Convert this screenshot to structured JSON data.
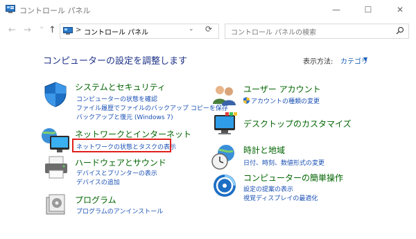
{
  "window": {
    "title": "コントロール パネル",
    "minimize": "—",
    "maximize": "☐",
    "close": "✕"
  },
  "nav": {
    "back": "←",
    "forward": "→",
    "recent": "⌄",
    "up": "↑"
  },
  "address": {
    "chevron": ">",
    "path": "コントロール パネル",
    "dropdown": "⌄",
    "refresh": "⟳"
  },
  "search": {
    "placeholder": "コントロール パネルの検索"
  },
  "main": {
    "heading": "コンピューターの設定を調整します",
    "view_by_label": "表示方法:",
    "view_by_value": "カテゴリ",
    "view_by_arrow": "▼"
  },
  "categories": [
    {
      "title": "システムとセキュリティ",
      "links": [
        "コンピューターの状態を確認",
        "ファイル履歴でファイルのバックアップ コピーを保存",
        "バックアップと復元 (Windows 7)"
      ]
    },
    {
      "title": "ネットワークとインターネット",
      "links": [
        "ネットワークの状態とタスクの表示"
      ]
    },
    {
      "title": "ハードウェアとサウンド",
      "links": [
        "デバイスとプリンターの表示",
        "デバイスの追加"
      ]
    },
    {
      "title": "プログラム",
      "links": [
        "プログラムのアンインストール"
      ]
    },
    {
      "title": "ユーザー アカウント",
      "links": [
        "アカウントの種類の変更"
      ]
    },
    {
      "title": "デスクトップのカスタマイズ",
      "links": []
    },
    {
      "title": "時計と地域",
      "links": [
        "日付、時刻、数値形式の変更"
      ]
    },
    {
      "title": "コンピューターの簡単操作",
      "links": [
        "設定の提案の表示",
        "視覚ディスプレイの最適化"
      ]
    }
  ],
  "colors": {
    "heading": "#1e3287",
    "category_title": "#006400",
    "link": "#1a50b4",
    "highlight": "#e0201a"
  }
}
